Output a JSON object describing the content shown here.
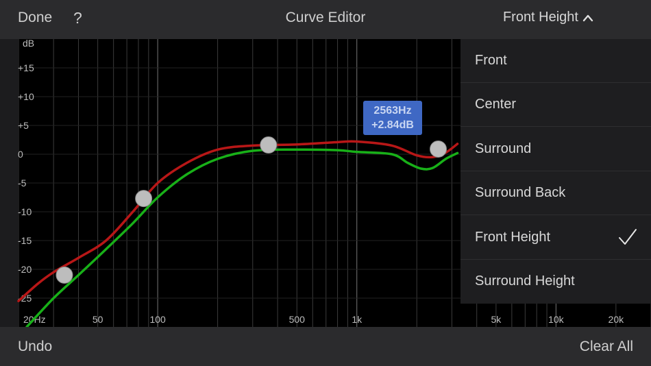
{
  "header": {
    "done_label": "Done",
    "help_label": "?",
    "title": "Curve Editor",
    "channel_selected": "Front Height"
  },
  "dropdown": {
    "items": [
      {
        "label": "Front",
        "checked": false
      },
      {
        "label": "Center",
        "checked": false
      },
      {
        "label": "Surround",
        "checked": false
      },
      {
        "label": "Surround Back",
        "checked": false
      },
      {
        "label": "Front Height",
        "checked": true
      },
      {
        "label": "Surround Height",
        "checked": false
      }
    ]
  },
  "footer": {
    "undo_label": "Undo",
    "clear_label": "Clear All"
  },
  "tooltip": {
    "line1": "2563Hz",
    "line2": "+2.84dB"
  },
  "chart_data": {
    "type": "line",
    "xscale": "log",
    "xlim": [
      20,
      30000
    ],
    "ylim": [
      -30,
      20
    ],
    "ylabel": "dB",
    "y_ticks": [
      15,
      10,
      5,
      0,
      -5,
      -10,
      -15,
      -20,
      -25
    ],
    "y_tick_labels": [
      "+15",
      "+10",
      "+5",
      "0",
      "-5",
      "-10",
      "-15",
      "-20",
      "-25"
    ],
    "x_tick_labels": [
      {
        "x": 20,
        "label": "20Hz"
      },
      {
        "x": 50,
        "label": "50"
      },
      {
        "x": 100,
        "label": "100"
      },
      {
        "x": 500,
        "label": "500"
      },
      {
        "x": 1000,
        "label": "1k"
      },
      {
        "x": 5000,
        "label": "5k"
      },
      {
        "x": 10000,
        "label": "10k"
      },
      {
        "x": 20000,
        "label": "20k"
      }
    ],
    "series": [
      {
        "color": "#b81717",
        "x": [
          20,
          25,
          30,
          40,
          55,
          75,
          100,
          140,
          200,
          300,
          500,
          800,
          1000,
          1500,
          2000,
          2400,
          2800,
          3200
        ],
        "y": [
          -25.5,
          -22.5,
          -20.5,
          -18,
          -15,
          -10,
          -5,
          -1.5,
          0.8,
          1.5,
          1.7,
          2.1,
          2.2,
          1.5,
          -0.2,
          -0.5,
          0.3,
          1.8
        ]
      },
      {
        "color": "#18b018",
        "x": [
          22,
          30,
          40,
          55,
          75,
          100,
          140,
          200,
          300,
          500,
          800,
          1000,
          1500,
          1800,
          2100,
          2400,
          2800,
          3200
        ],
        "y": [
          -30,
          -25,
          -21,
          -16.5,
          -12,
          -7.5,
          -3.5,
          -0.8,
          0.6,
          0.8,
          0.7,
          0.4,
          0,
          -1.5,
          -2.5,
          -2.4,
          -0.8,
          0.2
        ]
      }
    ],
    "control_points": [
      {
        "x": 34,
        "y": -21
      },
      {
        "x": 85,
        "y": -7.7
      },
      {
        "x": 360,
        "y": 1.6
      },
      {
        "x": 2563,
        "y": 0.9
      }
    ]
  }
}
